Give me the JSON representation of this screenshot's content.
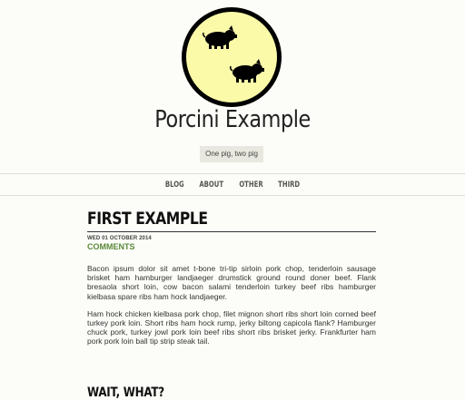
{
  "site": {
    "title": "Porcini Example",
    "tagline": "One pig, two pig",
    "logo_bg": "#fbfaa9"
  },
  "nav": {
    "items": [
      "BLOG",
      "ABOUT",
      "OTHER",
      "THIRD"
    ]
  },
  "post": {
    "title": "FIRST EXAMPLE",
    "date": "WED 01 OCTOBER 2014",
    "comments": "COMMENTS",
    "paragraphs": [
      "Bacon ipsum dolor sit amet t-bone tri-tip sirloin pork chop, tenderloin sausage brisket ham hamburger landjaeger drumstick ground round doner beef. Flank bresaola short loin, cow bacon salami tenderloin turkey beef ribs hamburger kielbasa spare ribs ham hock landjaeger.",
      "Ham hock chicken kielbasa pork chop, filet mignon short ribs short loin corned beef turkey pork loin. Short ribs ham hock rump, jerky biltong capicola flank? Hamburger chuck pork, turkey jowl pork loin beef ribs short ribs brisket jerky. Frankfurter ham pork pork loin ball tip strip steak tail."
    ]
  },
  "next_post": {
    "title": "WAIT, WHAT?"
  }
}
